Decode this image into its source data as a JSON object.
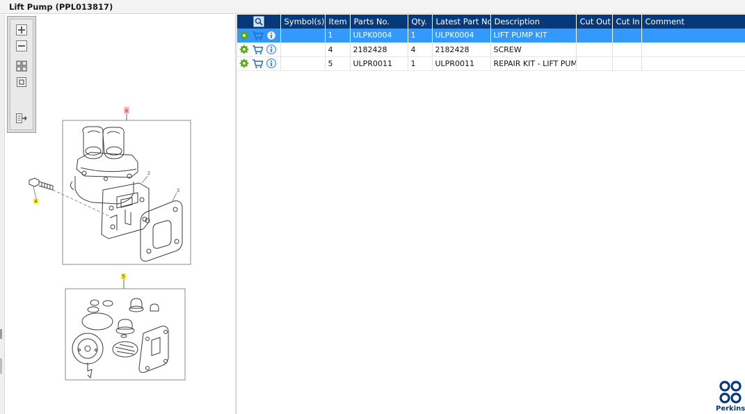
{
  "window": {
    "title": "Lift Pump (PPL013817)"
  },
  "toolbar": {
    "buttons": [
      {
        "name": "zoom-in",
        "icon": "zoom-in-icon"
      },
      {
        "name": "zoom-out",
        "icon": "zoom-out-icon"
      },
      {
        "name": "fit-all",
        "icon": "fit-all-icon"
      },
      {
        "name": "actual-size",
        "icon": "actual-size-icon"
      },
      {
        "name": "export",
        "icon": "export-icon"
      }
    ]
  },
  "drawing": {
    "callouts": [
      {
        "label": "6",
        "color": "#ff6b6b"
      },
      {
        "label": "2",
        "color": "#555555"
      },
      {
        "label": "3",
        "color": "#555555"
      },
      {
        "label": "4",
        "color": "#ffee33"
      },
      {
        "label": "5",
        "color": "#ffee33"
      }
    ]
  },
  "parts_table": {
    "columns": [
      "",
      "Symbol(s)",
      "Item",
      "Parts No.",
      "Qty.",
      "Latest Part No.",
      "Description",
      "Cut Out",
      "Cut In",
      "Comment"
    ],
    "rows": [
      {
        "selected": true,
        "item": "1",
        "part_no": "ULPK0004",
        "qty": "1",
        "latest_part_no": "ULPK0004",
        "description": "LIFT PUMP KIT",
        "cut_out": "",
        "cut_in": "",
        "comment": ""
      },
      {
        "selected": false,
        "item": "4",
        "part_no": "2182428",
        "qty": "4",
        "latest_part_no": "2182428",
        "description": "SCREW",
        "cut_out": "",
        "cut_in": "",
        "comment": ""
      },
      {
        "selected": false,
        "item": "5",
        "part_no": "ULPR0011",
        "qty": "1",
        "latest_part_no": "ULPR0011",
        "description": "REPAIR KIT - LIFT PUMP",
        "cut_out": "",
        "cut_in": "",
        "comment": ""
      }
    ]
  },
  "branding": {
    "logo_text": "Perkins",
    "color": "#05397a"
  },
  "colors": {
    "header_bg": "#05397a",
    "selected_row": "#3399ff",
    "gear": "#5aa51b",
    "cart": "#1a6fc4",
    "info": "#3b7fcf"
  }
}
